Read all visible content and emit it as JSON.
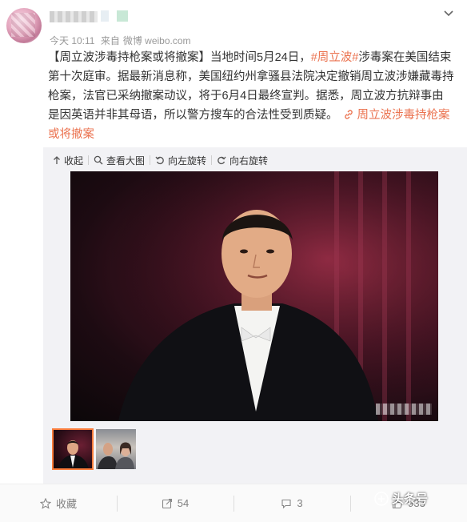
{
  "post": {
    "time": "今天 10:11",
    "source_prefix": "来自",
    "source": "微博 weibo.com",
    "text": {
      "tag_title": "【周立波涉毒持枪案或将撤案】",
      "seg1": "当地时间5月24日，",
      "hashtag": "#周立波#",
      "seg2": "涉毒案在美国结束第十次庭审。据最新消息称，美国纽约州拿骚县法院决定撤销周立波涉嫌藏毒持枪案，法官已采纳撤案动议，将于6月4日最终宣判。据悉，周立波方抗辩事由是因英语并非其母语，所以警方搜车的合法性受到质疑。",
      "link_label": "周立波涉毒持枪案或将撤案"
    }
  },
  "media_toolbar": {
    "collapse": "收起",
    "view_large": "查看大图",
    "rotate_left": "向左旋转",
    "rotate_right": "向右旋转"
  },
  "actions": {
    "favorite": "收藏",
    "repost_count": "54",
    "comment_count": "3",
    "like_count": "933"
  },
  "watermark": {
    "brand": "头条号"
  },
  "colors": {
    "link": "#eb7350",
    "active_thumb": "#fa7d3c"
  }
}
